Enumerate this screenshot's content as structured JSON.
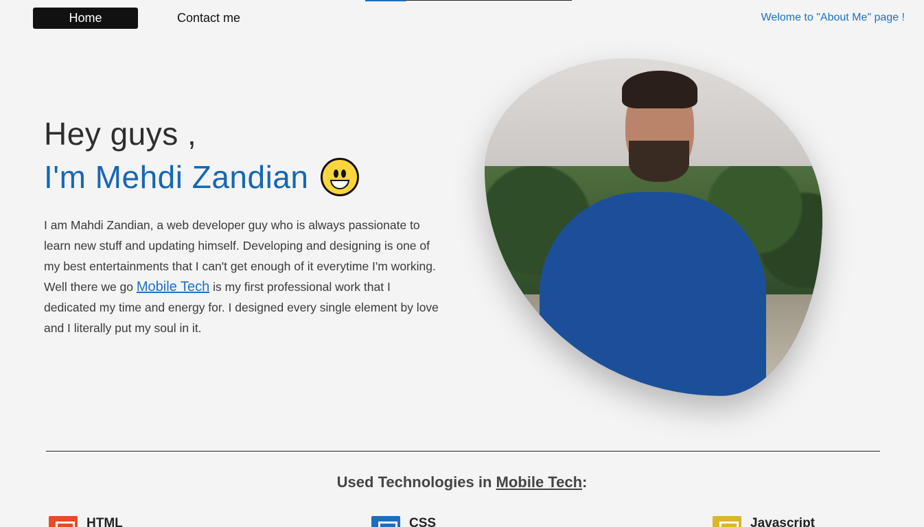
{
  "nav": {
    "home_label": "Home",
    "contact_label": "Contact me",
    "welcome_text": "Welome to \"About Me\" page !"
  },
  "hero": {
    "greeting": "Hey guys ,",
    "name_line": "I'm Mehdi Zandian",
    "bio_before_link": "I am Mahdi Zandian, a web developer guy who is always passionate to learn new stuff and updating himself. Developing and designing is one of my best entertainments that I can't get enough of it everytime I'm working. Well there we go ",
    "bio_link": "Mobile Tech",
    "bio_after_link": " is my first professional work that I dedicated my time and energy for. I designed every single element by love and I literally put my soul in it."
  },
  "technologies": {
    "title_before": "Used Technologies in ",
    "title_link": "Mobile Tech",
    "title_after": ":",
    "items": [
      {
        "label": "HTML",
        "icon": "html5-icon",
        "color": "#e44d26"
      },
      {
        "label": "CSS",
        "icon": "css3-icon",
        "color": "#1f6dbd"
      },
      {
        "label": "Javascript",
        "icon": "javascript-icon",
        "color": "#d8b82a"
      }
    ]
  },
  "colors": {
    "accent": "#1567b3",
    "link": "#1a73c9",
    "nav_active_bg": "#111111",
    "background": "#f4f4f4"
  }
}
